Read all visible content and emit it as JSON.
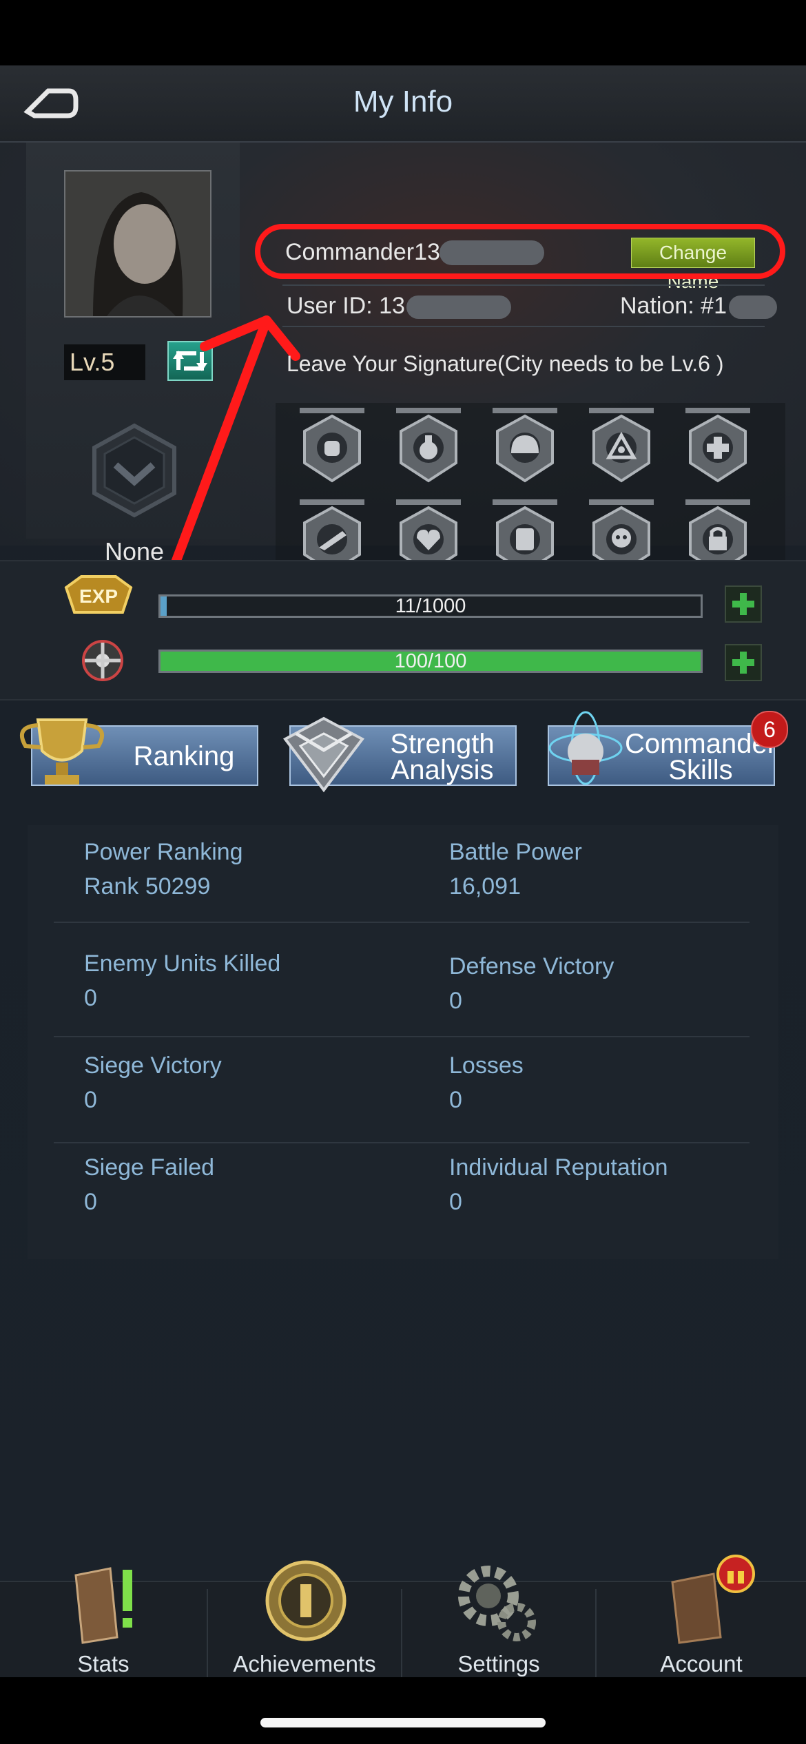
{
  "header": {
    "title": "My Info"
  },
  "profile": {
    "level": "Lv.5",
    "title_slot": "None",
    "name": "Commander13",
    "change_name_label": "Change Name",
    "user_id": "User ID: 13",
    "nation": "Nation: #1",
    "signature_hint": "Leave Your Signature(City needs to be Lv.6 )"
  },
  "badges": [
    "fist-badge-icon",
    "potion-badge-icon",
    "helmet-badge-icon",
    "biohazard-badge-icon",
    "medic-badge-icon",
    "rifle-badge-icon",
    "heart-badge-icon",
    "vest-badge-icon",
    "skull-badge-icon",
    "lock-badge-icon"
  ],
  "progress": {
    "exp": {
      "text": "11/1000",
      "fraction": 0.011
    },
    "stamina": {
      "text": "100/100",
      "fraction": 1.0
    }
  },
  "features": {
    "ranking": "Ranking",
    "strength_line1": "Strength",
    "strength_line2": "Analysis",
    "commander_line1": "Commander",
    "commander_line2": "Skills",
    "commander_badge": "6"
  },
  "stats": [
    {
      "label": "Power Ranking",
      "value": "Rank 50299"
    },
    {
      "label": "Battle Power",
      "value": "16,091"
    },
    {
      "label": "Enemy Units Killed",
      "value": "0"
    },
    {
      "label": "Defense Victory",
      "value": "0"
    },
    {
      "label": "Siege Victory",
      "value": "0"
    },
    {
      "label": "Losses",
      "value": "0"
    },
    {
      "label": "Siege Failed",
      "value": "0"
    },
    {
      "label": "Individual Reputation",
      "value": "0"
    }
  ],
  "nav": [
    {
      "label": "Stats"
    },
    {
      "label": "Achievements"
    },
    {
      "label": "Settings"
    },
    {
      "label": "Account"
    }
  ],
  "colors": {
    "annotation": "#ff1a1a",
    "accent_green": "#3fb84a",
    "stat_text": "#8fb8d8",
    "button_blue": "#5a7aa3"
  }
}
